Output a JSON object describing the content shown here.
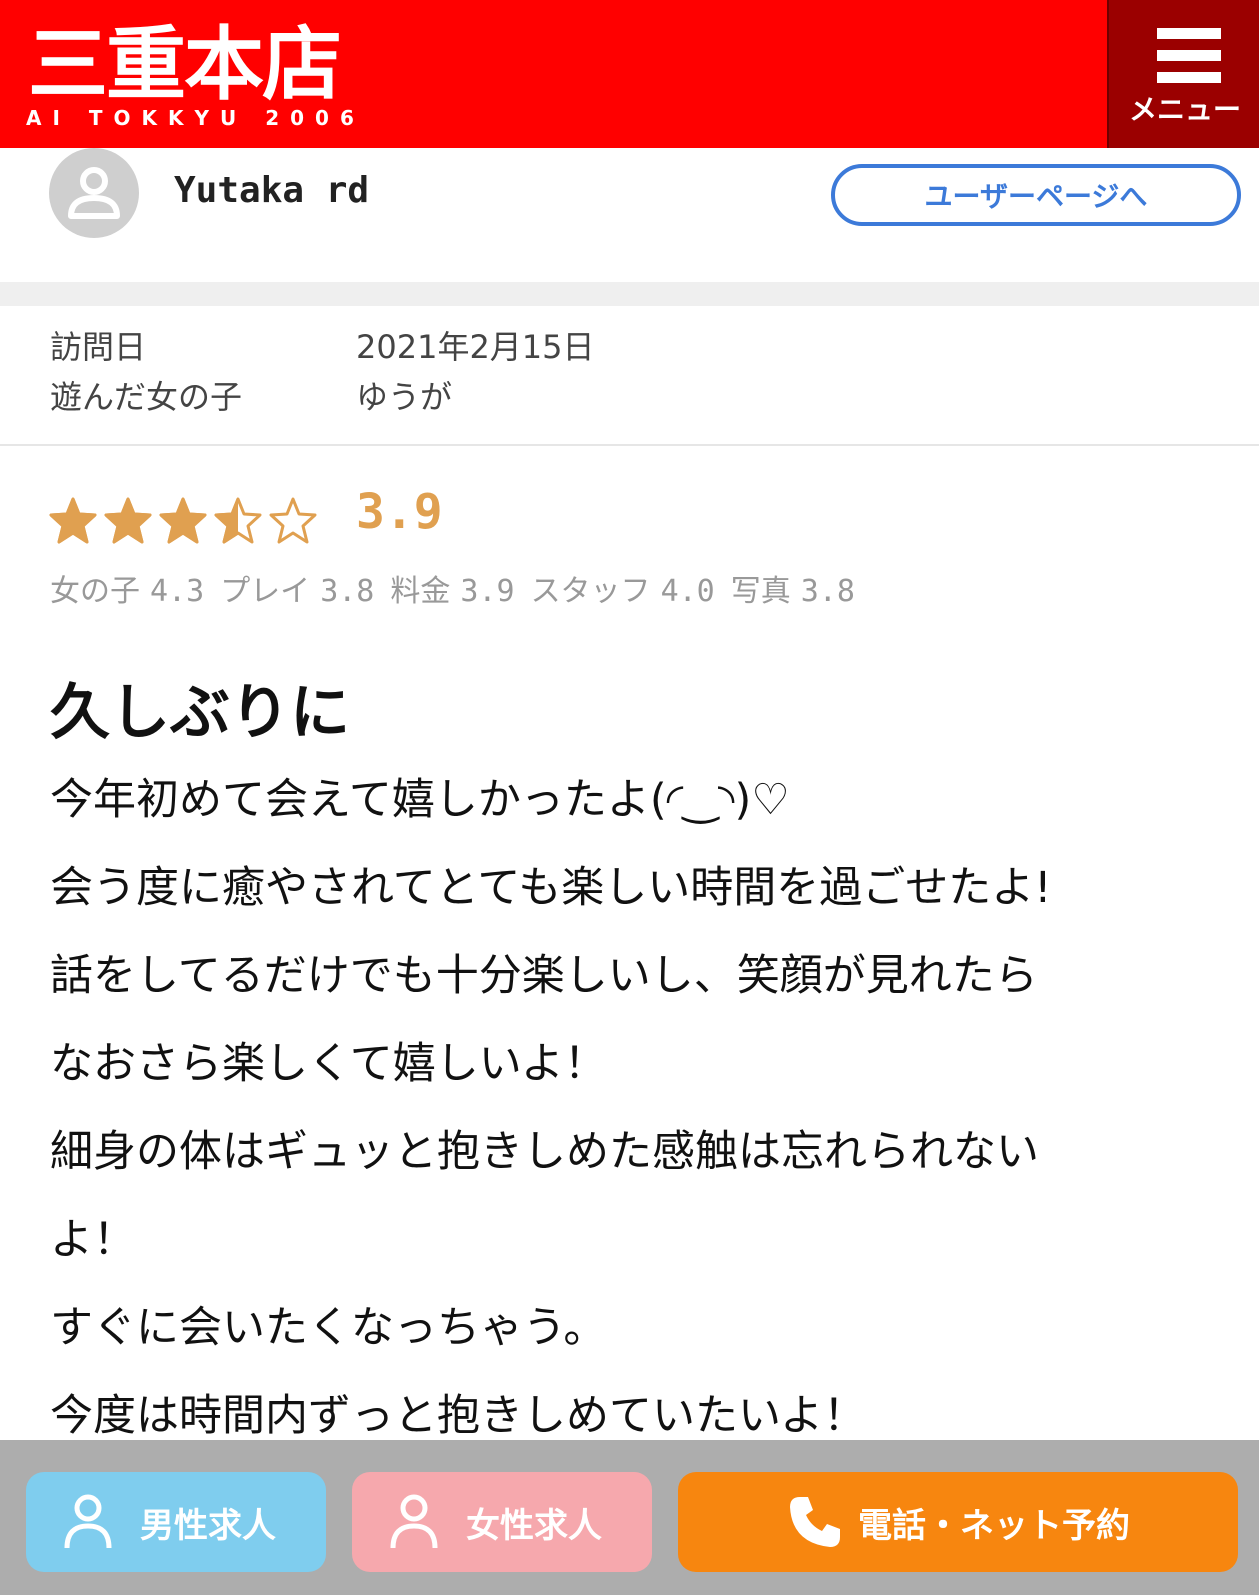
{
  "header": {
    "logo_main": "三重本店",
    "logo_sub": "AI TOKKYU 2006",
    "menu_label": "メニュー"
  },
  "user": {
    "name": "Yutaka rd",
    "user_page_button": "ユーザーページへ"
  },
  "info": {
    "visit_date_label": "訪問日",
    "visit_date_value": "2021年2月15日",
    "girl_label": "遊んだ女の子",
    "girl_value": "ゆうが"
  },
  "rating": {
    "overall": "3.9",
    "stars": 3.5,
    "star_color": "#e0a050",
    "sub": [
      {
        "label": "女の子",
        "value": "4.3"
      },
      {
        "label": "プレイ",
        "value": "3.8"
      },
      {
        "label": "料金",
        "value": "3.9"
      },
      {
        "label": "スタッフ",
        "value": "4.0"
      },
      {
        "label": "写真",
        "value": "3.8"
      }
    ]
  },
  "review": {
    "title": "久しぶりに",
    "lines": [
      "今年初めて会えて嬉しかったよ(◜‿◝)♡",
      "会う度に癒やされてとても楽しい時間を過ごせたよ!",
      "話をしてるだけでも十分楽しいし、笑顔が見れたら",
      "なおさら楽しくて嬉しいよ！",
      "細身の体はギュッと抱きしめた感触は忘れられない",
      "よ！",
      "すぐに会いたくなっちゃう。",
      "今度は時間内ずっと抱きしめていたいよ！"
    ]
  },
  "bottom_bar": {
    "male_jobs": "男性求人",
    "female_jobs": "女性求人",
    "reserve": "電話・ネット予約",
    "colors": {
      "male": "#7fcdee",
      "female": "#f6a8ad",
      "reserve": "#f7860f"
    }
  }
}
